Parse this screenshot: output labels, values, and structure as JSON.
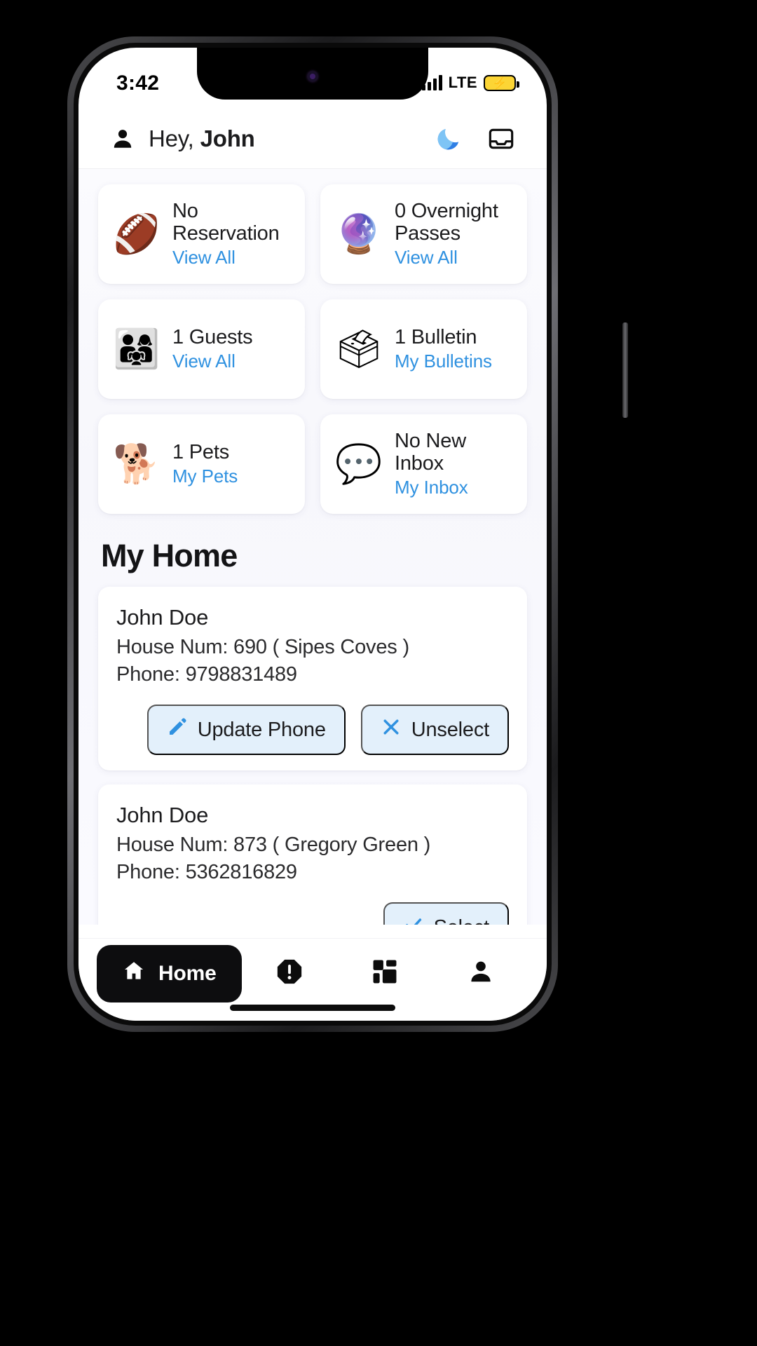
{
  "status_bar": {
    "time": "3:42",
    "network": "LTE",
    "battery_icon": "battery-charging-icon",
    "signal_icon": "signal-bars-icon"
  },
  "header": {
    "avatar_icon": "person-icon",
    "greeting_prefix": "Hey, ",
    "user_name": "John",
    "theme_toggle_icon": "moon-icon",
    "inbox_icon": "tray-icon"
  },
  "tiles": [
    {
      "emoji": "🏈",
      "icon_name": "football-icon",
      "title": "No Reservation",
      "link": "View All",
      "link_color": "#2f91e0"
    },
    {
      "emoji": "🔮",
      "icon_name": "crystal-ball-icon",
      "title": "0 Overnight Passes",
      "link": "View All",
      "link_color": "#2f91e0"
    },
    {
      "emoji": "👨‍👩‍👧",
      "icon_name": "family-group-icon",
      "title": "1 Guests",
      "link": "View All",
      "link_color": "#2f91e0"
    },
    {
      "emoji": "🗳",
      "icon_name": "bulletin-board-icon",
      "title": "1 Bulletin",
      "link": "My Bulletins",
      "link_color": "#2f91e0"
    },
    {
      "emoji": "🐕",
      "icon_name": "dog-icon",
      "title": "1 Pets",
      "link": "My Pets",
      "link_color": "#2f91e0"
    },
    {
      "emoji": "💬",
      "icon_name": "speech-bubble-icon",
      "title": "No New Inbox",
      "link": "My Inbox",
      "link_color": "#2f91e0"
    }
  ],
  "my_home": {
    "section_title": "My Home",
    "addresses": [
      {
        "name": "John Doe",
        "house": "House Num: 690 ( Sipes Coves )",
        "phone": "Phone: 9798831489",
        "actions": [
          {
            "label": "Update Phone",
            "icon": "pencil-icon"
          },
          {
            "label": "Unselect",
            "icon": "close-x-icon"
          }
        ]
      },
      {
        "name": "John Doe",
        "house": "House Num: 873 ( Gregory Green )",
        "phone": "Phone: 5362816829",
        "actions": [
          {
            "label": "Select",
            "icon": "check-icon"
          }
        ]
      }
    ]
  },
  "bottom_nav": {
    "active_label": "Home",
    "items": [
      {
        "label": "Home",
        "icon": "house-icon"
      },
      {
        "label": "",
        "icon": "alert-octagon-icon"
      },
      {
        "label": "",
        "icon": "grid-squares-icon"
      },
      {
        "label": "",
        "icon": "person-icon"
      }
    ]
  },
  "colors": {
    "accent_blue": "#2f91e0",
    "pill_bg": "#e3f0fb",
    "nav_active_bg": "#0d0d0f",
    "text_primary": "#1c1c1e"
  }
}
